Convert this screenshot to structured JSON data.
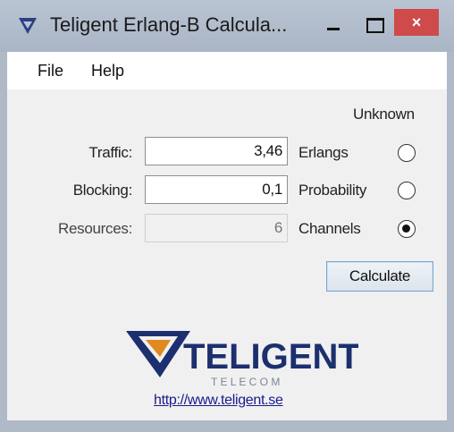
{
  "window": {
    "title": "Teligent Erlang-B Calcula...",
    "close_glyph": "×"
  },
  "menu": {
    "file": "File",
    "help": "Help"
  },
  "form": {
    "unknown_label": "Unknown",
    "rows": [
      {
        "label": "Traffic:",
        "value": "3,46",
        "unit": "Erlangs",
        "selected": false,
        "enabled": true
      },
      {
        "label": "Blocking:",
        "value": "0,1",
        "unit": "Probability",
        "selected": false,
        "enabled": true
      },
      {
        "label": "Resources:",
        "value": "6",
        "unit": "Channels",
        "selected": true,
        "enabled": false
      }
    ],
    "calculate_label": "Calculate"
  },
  "logo": {
    "name": "TELIGENT",
    "tagline": "T E L E C O M"
  },
  "link": "http://www.teligent.se",
  "colors": {
    "titlebar": "#aab5c5",
    "close_button": "#cf4a4a",
    "logo_navy": "#1c2f6e",
    "logo_orange": "#e08a1e",
    "link": "#1a1a8c"
  }
}
